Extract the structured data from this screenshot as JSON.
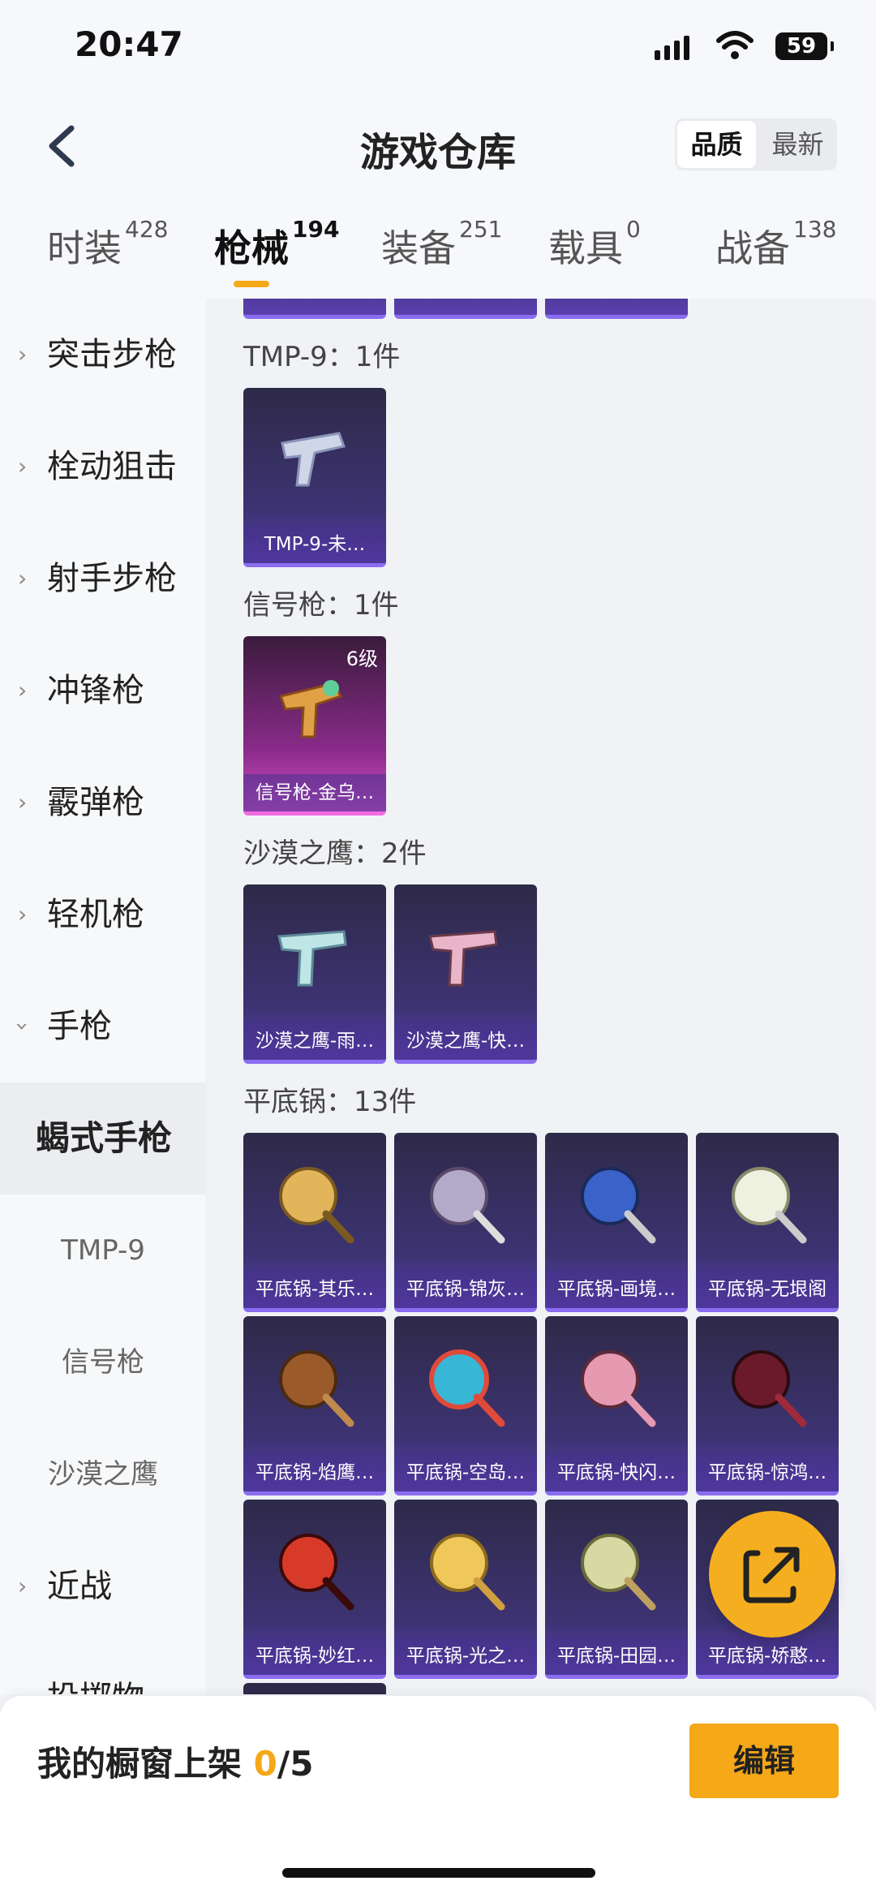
{
  "status_bar": {
    "time": "20:47",
    "battery": "59"
  },
  "header": {
    "title": "游戏仓库",
    "sort_options": [
      "品质",
      "最新"
    ],
    "sort_active": "品质"
  },
  "tabs": [
    {
      "label": "时装",
      "count": "428"
    },
    {
      "label": "枪械",
      "count": "194",
      "active": true
    },
    {
      "label": "装备",
      "count": "251"
    },
    {
      "label": "载具",
      "count": "0"
    },
    {
      "label": "战备",
      "count": "138"
    }
  ],
  "sidebar": {
    "items": [
      {
        "label": "突击步枪"
      },
      {
        "label": "栓动狙击"
      },
      {
        "label": "射手步枪"
      },
      {
        "label": "冲锋枪"
      },
      {
        "label": "霰弹枪"
      },
      {
        "label": "轻机枪"
      },
      {
        "label": "手枪"
      },
      {
        "label": "蝎式手枪"
      },
      {
        "label": "TMP-9"
      },
      {
        "label": "信号枪"
      },
      {
        "label": "沙漠之鹰"
      },
      {
        "label": "近战"
      },
      {
        "label": "投掷物"
      }
    ]
  },
  "sections": [
    {
      "title": "TMP-9：1件",
      "items": [
        {
          "name": "TMP-9-未…"
        }
      ]
    },
    {
      "title": "信号枪：1件",
      "items": [
        {
          "name": "信号枪-金乌…",
          "level": "6级",
          "rarity": "pink"
        }
      ]
    },
    {
      "title": "沙漠之鹰：2件",
      "items": [
        {
          "name": "沙漠之鹰-雨…"
        },
        {
          "name": "沙漠之鹰-快…"
        }
      ]
    },
    {
      "title": "平底锅：13件",
      "items": [
        {
          "name": "平底锅-其乐…"
        },
        {
          "name": "平底锅-锦灰…"
        },
        {
          "name": "平底锅-画境…"
        },
        {
          "name": "平底锅-无垠阁"
        },
        {
          "name": "平底锅-焰鹰…"
        },
        {
          "name": "平底锅-空岛…"
        },
        {
          "name": "平底锅-快闪…"
        },
        {
          "name": "平底锅-惊鸿…"
        },
        {
          "name": "平底锅-妙红…"
        },
        {
          "name": "平底锅-光之…"
        },
        {
          "name": "平底锅-田园…"
        },
        {
          "name": "平底锅-娇憨…"
        }
      ]
    }
  ],
  "bottom_bar": {
    "showcase_label": "我的橱窗上架",
    "showcase_current": "0",
    "showcase_total": "/5",
    "edit_label": "编辑"
  },
  "colors": {
    "accent": "#f5a818",
    "card_purple": "#3d3373",
    "card_pink": "#d44fc6"
  },
  "icons": [
    "back-icon",
    "chevron-right-icon",
    "chevron-down-icon",
    "share-icon",
    "wifi-icon",
    "signal-icon",
    "battery-icon"
  ]
}
